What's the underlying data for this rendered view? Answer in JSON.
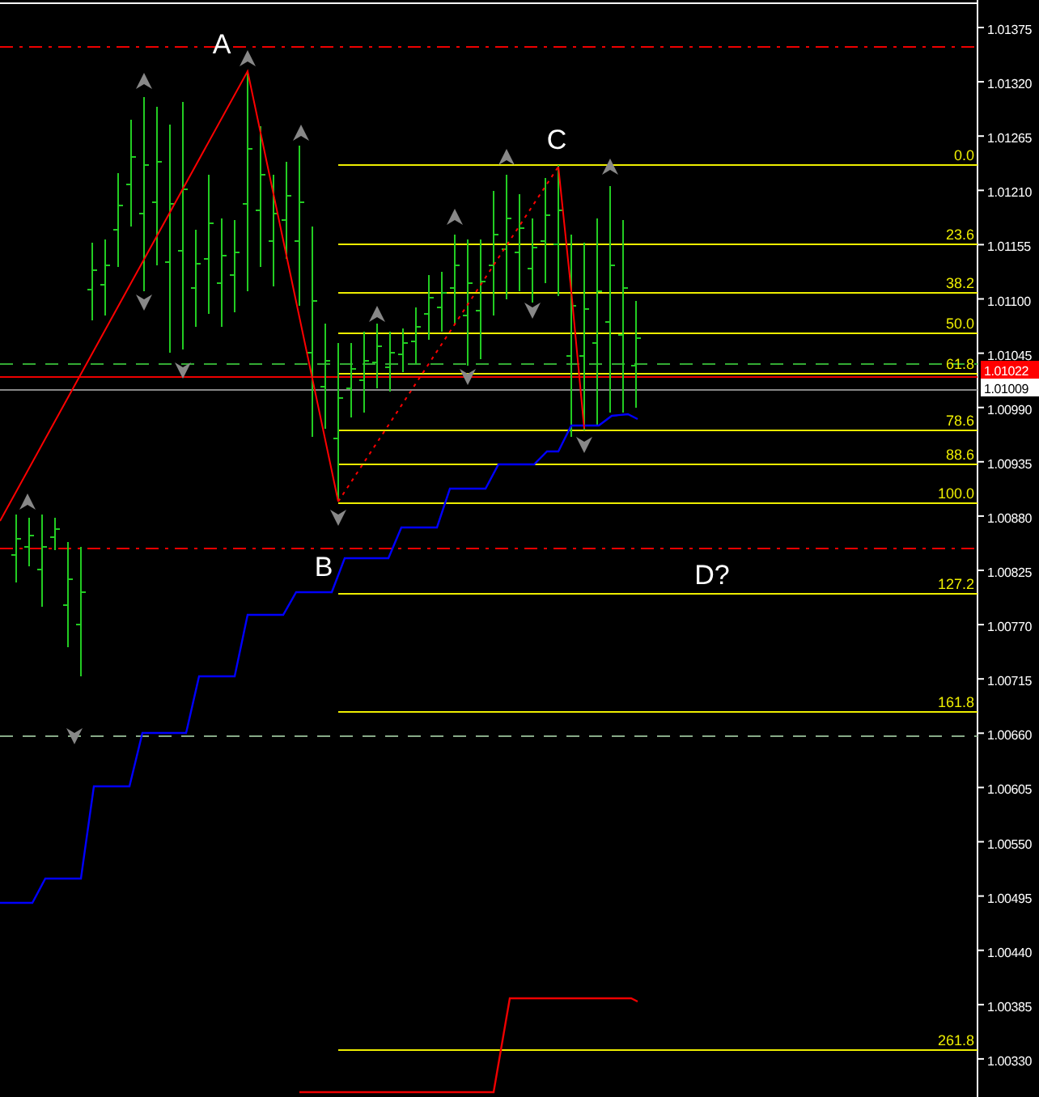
{
  "price_axis": {
    "labels": [
      "1.01375",
      "1.01320",
      "1.01265",
      "1.01210",
      "1.01155",
      "1.01100",
      "1.01045",
      "1.00990",
      "1.00935",
      "1.00880",
      "1.00825",
      "1.00770",
      "1.00715",
      "1.00660",
      "1.00605",
      "1.00550",
      "1.00495",
      "1.00440",
      "1.00385",
      "1.00330"
    ]
  },
  "price_tags": [
    {
      "label": "1.01022",
      "color": "#ff0000"
    },
    {
      "label": "1.01009",
      "color": "#ffffff"
    }
  ],
  "fibonacci_levels": [
    "0.0",
    "23.6",
    "38.2",
    "50.0",
    "61.8",
    "78.6",
    "88.6",
    "100.0",
    "127.2",
    "161.8",
    "261.8"
  ],
  "point_labels": [
    "A",
    "B",
    "C",
    "D?"
  ]
}
